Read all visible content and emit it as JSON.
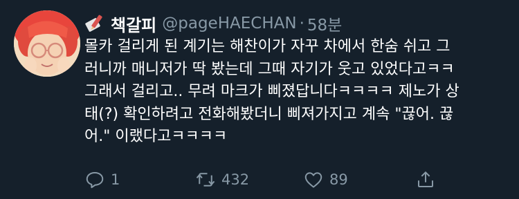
{
  "tweet": {
    "display_name": "책갈피",
    "handle": "@pageHAECHAN",
    "separator": "·",
    "time": "58분",
    "body_lines": [
      "몰카 걸리게 된 계기는 해찬이가 자꾸 차에서 한숨 쉬고 그",
      "러니까 매니저가 딱 봤는데 그때 자기가 웃고 있었다고ㅋㅋ",
      "그래서 걸리고.. 무려 마크가 삐졌답니다ㅋㅋㅋㅋ 제노가 상",
      "태(?) 확인하려고 전화해봤더니 삐져가지고 계속 \"끊어. 끊",
      "어.\" 이랬다고ㅋㅋㅋㅋ"
    ],
    "actions": {
      "reply_count": "1",
      "retweet_count": "432",
      "like_count": "89"
    },
    "icons": {
      "reply": "reply-icon",
      "retweet": "retweet-icon",
      "like": "heart-icon",
      "share": "share-icon",
      "name_badge": "bookmark-pencil-icon"
    }
  },
  "colors": {
    "background": "#15202b",
    "text_primary": "#ffffff",
    "text_secondary": "#8899a6",
    "avatar_hair": "#e8453c"
  }
}
